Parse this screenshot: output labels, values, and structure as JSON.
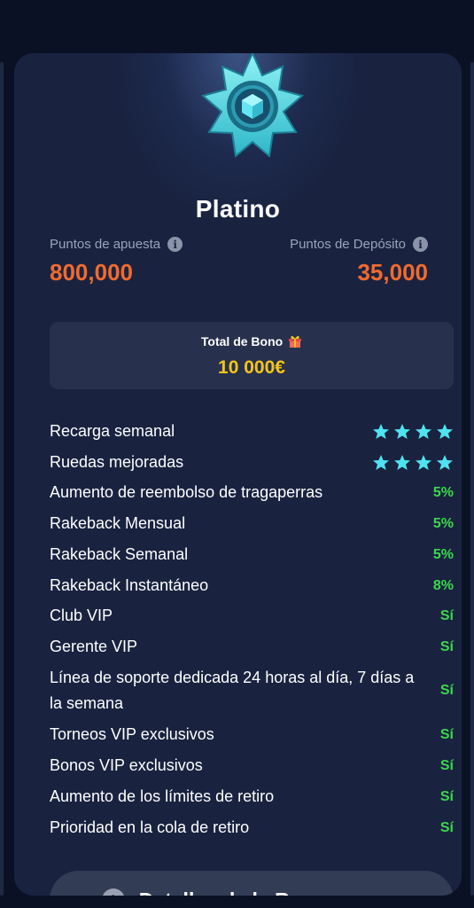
{
  "level": {
    "title": "Platino"
  },
  "points": {
    "bet_label": "Puntos de apuesta",
    "bet_value": "800,000",
    "deposit_label": "Puntos de Depósito",
    "deposit_value": "35,000"
  },
  "bonus": {
    "label": "Total de Bono",
    "value": "10 000€"
  },
  "benefits": [
    {
      "name": "Recarga semanal",
      "value": "",
      "stars": 4
    },
    {
      "name": "Ruedas mejoradas",
      "value": "",
      "stars": 4
    },
    {
      "name": "Aumento de reembolso de tragaperras",
      "value": "5%"
    },
    {
      "name": "Rakeback Mensual",
      "value": "5%"
    },
    {
      "name": "Rakeback Semanal",
      "value": "5%"
    },
    {
      "name": "Rakeback Instantáneo",
      "value": "8%"
    },
    {
      "name": "Club VIP",
      "value": "Sí"
    },
    {
      "name": "Gerente VIP",
      "value": "Sí"
    },
    {
      "name": "Línea de soporte dedicada 24 horas al día, 7 días a la semana",
      "value": "Sí"
    },
    {
      "name": "Torneos VIP exclusivos",
      "value": "Sí"
    },
    {
      "name": "Bonos VIP exclusivos",
      "value": "Sí"
    },
    {
      "name": "Aumento de los límites de retiro",
      "value": "Sí"
    },
    {
      "name": "Prioridad en la cola de retiro",
      "value": "Sí"
    }
  ],
  "details_button": {
    "label": "Detalles de la Recompensa"
  },
  "icons": {
    "info": "info-icon",
    "gift": "gift-icon",
    "star": "star-icon",
    "badge": "platinum-badge-icon"
  },
  "colors": {
    "accent_orange": "#f26a2e",
    "bonus_yellow": "#f5c518",
    "value_green": "#3bd94a",
    "star_cyan": "#4ee3ef"
  }
}
